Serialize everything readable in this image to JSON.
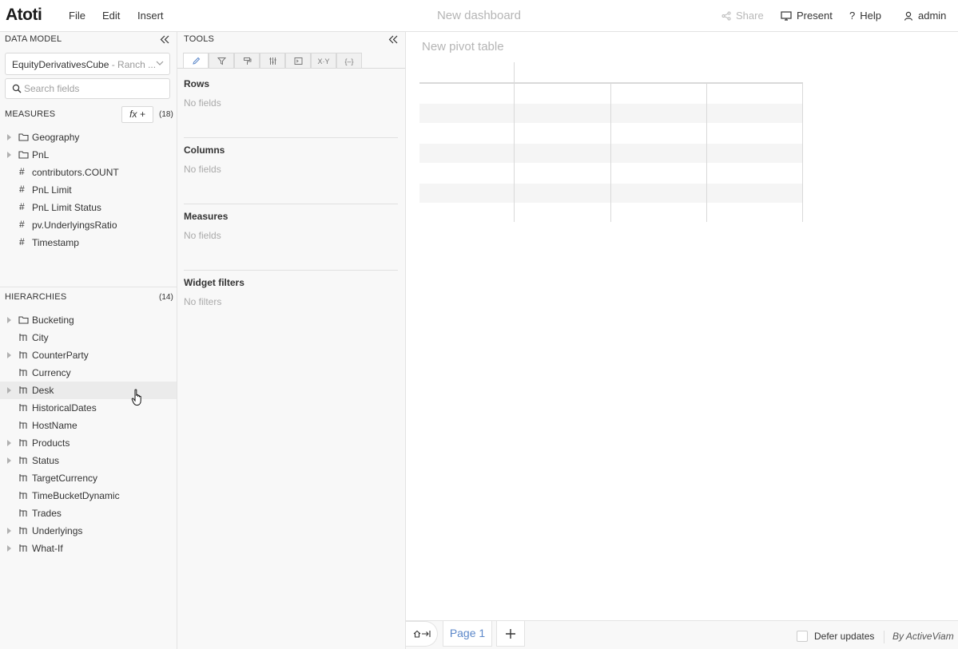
{
  "app": {
    "logo": "Atoti"
  },
  "menu": {
    "file": "File",
    "edit": "Edit",
    "insert": "Insert"
  },
  "dashboard": {
    "title": "New dashboard"
  },
  "header": {
    "share": "Share",
    "present": "Present",
    "help": "Help",
    "user": "admin"
  },
  "data_model": {
    "heading": "DATA MODEL",
    "cube_name": "EquityDerivativesCube",
    "cube_sub": " - Ranch ...",
    "search_placeholder": "Search fields",
    "measures_heading": "MEASURES",
    "fx_label": "fx  +",
    "measures_count": "(18)",
    "measures": [
      {
        "label": "Geography",
        "kind": "folder"
      },
      {
        "label": "PnL",
        "kind": "folder"
      },
      {
        "label": "contributors.COUNT",
        "kind": "measure"
      },
      {
        "label": "PnL Limit",
        "kind": "measure"
      },
      {
        "label": "PnL Limit Status",
        "kind": "measure"
      },
      {
        "label": "pv.UnderlyingsRatio",
        "kind": "measure"
      },
      {
        "label": "Timestamp",
        "kind": "measure"
      }
    ],
    "hierarchies_heading": "HIERARCHIES",
    "hierarchies_count": "(14)",
    "hierarchies": [
      {
        "label": "Bucketing",
        "kind": "folder"
      },
      {
        "label": "City",
        "kind": "hierarchy"
      },
      {
        "label": "CounterParty",
        "kind": "hierarchy"
      },
      {
        "label": "Currency",
        "kind": "hierarchy"
      },
      {
        "label": "Desk",
        "kind": "hierarchy"
      },
      {
        "label": "HistoricalDates",
        "kind": "hierarchy"
      },
      {
        "label": "HostName",
        "kind": "hierarchy"
      },
      {
        "label": "Products",
        "kind": "hierarchy"
      },
      {
        "label": "Status",
        "kind": "hierarchy"
      },
      {
        "label": "TargetCurrency",
        "kind": "hierarchy"
      },
      {
        "label": "TimeBucketDynamic",
        "kind": "hierarchy"
      },
      {
        "label": "Trades",
        "kind": "hierarchy"
      },
      {
        "label": "Underlyings",
        "kind": "hierarchy"
      },
      {
        "label": "What-If",
        "kind": "hierarchy"
      }
    ]
  },
  "tools": {
    "heading": "TOOLS",
    "tabs": [
      "",
      "",
      "",
      "",
      "",
      "X·Y",
      "{–}"
    ],
    "rows": {
      "title": "Rows",
      "empty": "No fields"
    },
    "columns": {
      "title": "Columns",
      "empty": "No fields"
    },
    "measures": {
      "title": "Measures",
      "empty": "No fields"
    },
    "filters": {
      "title": "Widget filters",
      "empty": "No filters"
    }
  },
  "widget": {
    "title": "New pivot table"
  },
  "footer": {
    "page": "Page 1",
    "defer": "Defer updates",
    "by": "By ActiveViam"
  }
}
